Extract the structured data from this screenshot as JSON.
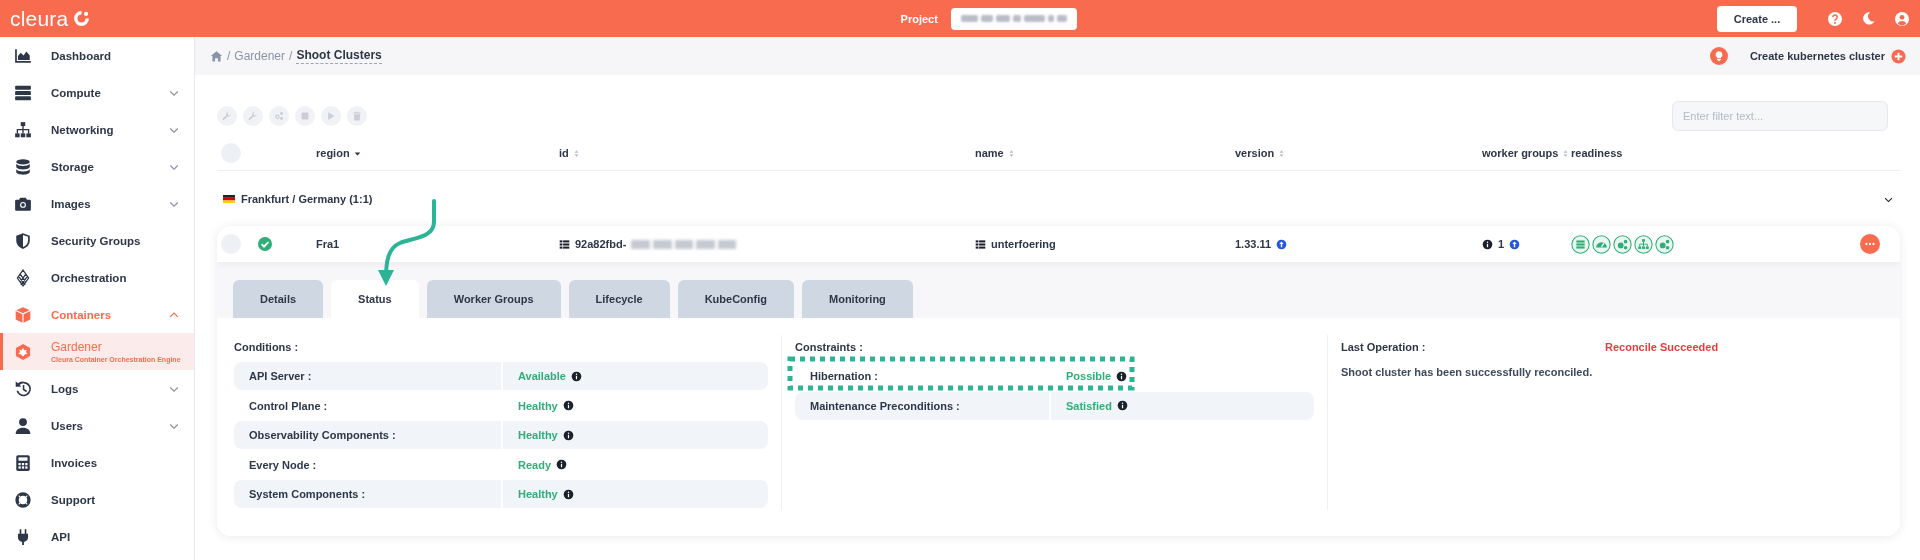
{
  "topbar": {
    "logo": "cleura",
    "project_label": "Project",
    "create_button": "Create ..."
  },
  "sidebar": {
    "items": [
      {
        "label": "Dashboard",
        "expandable": false,
        "expanded": false,
        "active": false,
        "selected": false
      },
      {
        "label": "Compute",
        "expandable": true,
        "expanded": false,
        "active": false,
        "selected": false
      },
      {
        "label": "Networking",
        "expandable": true,
        "expanded": false,
        "active": false,
        "selected": false
      },
      {
        "label": "Storage",
        "expandable": true,
        "expanded": false,
        "active": false,
        "selected": false
      },
      {
        "label": "Images",
        "expandable": true,
        "expanded": false,
        "active": false,
        "selected": false
      },
      {
        "label": "Security Groups",
        "expandable": false,
        "expanded": false,
        "active": false,
        "selected": false
      },
      {
        "label": "Orchestration",
        "expandable": false,
        "expanded": false,
        "active": false,
        "selected": false
      },
      {
        "label": "Containers",
        "expandable": true,
        "expanded": true,
        "active": true,
        "selected": false
      },
      {
        "label": "Gardener",
        "subtitle": "Cleura Container Orchestration Engine",
        "expandable": false,
        "expanded": false,
        "active": false,
        "selected": true
      },
      {
        "label": "Logs",
        "expandable": true,
        "expanded": false,
        "active": false,
        "selected": false
      },
      {
        "label": "Users",
        "expandable": true,
        "expanded": false,
        "active": false,
        "selected": false
      },
      {
        "label": "Invoices",
        "expandable": false,
        "expanded": false,
        "active": false,
        "selected": false
      },
      {
        "label": "Support",
        "expandable": false,
        "expanded": false,
        "active": false,
        "selected": false
      },
      {
        "label": "API",
        "expandable": false,
        "expanded": false,
        "active": false,
        "selected": false
      }
    ]
  },
  "breadcrumb": [
    {
      "kind": "home"
    },
    {
      "kind": "separator",
      "text": "/"
    },
    {
      "kind": "link",
      "text": "Gardener"
    },
    {
      "kind": "separator",
      "text": "/"
    },
    {
      "kind": "current",
      "text": "Shoot Clusters"
    }
  ],
  "create_cluster": "Create kubernetes cluster",
  "toolbar": [
    {
      "disabled": true
    },
    {
      "disabled": true
    },
    {
      "disabled": true
    },
    {
      "disabled": true
    },
    {
      "disabled": true
    },
    {
      "disabled": true
    }
  ],
  "filter": {
    "placeholder": "Enter filter text..."
  },
  "table": {
    "select_all": {
      "checked": false
    },
    "columns": [
      {
        "label": "region",
        "sortable": true,
        "sorted": true
      },
      {
        "label": "id",
        "sortable": true,
        "sorted": false
      },
      {
        "label": "name",
        "sortable": true,
        "sorted": false
      },
      {
        "label": "version",
        "sortable": true,
        "sorted": false
      },
      {
        "label": "worker groups",
        "sortable": true,
        "sorted": false
      },
      {
        "label": "readiness",
        "sortable": false,
        "sorted": false
      }
    ],
    "group": {
      "label": "Frankfurt / Germany (1:1)",
      "expanded": true
    },
    "row": {
      "checked": false,
      "healthy": true,
      "region": "Fra1",
      "id": "92a82fbd-",
      "name": "unterfoering",
      "version": "1.33.11",
      "version_upgradable": true,
      "worker_groups": "1",
      "workers_upgradable": true,
      "readiness": [
        {
          "ready": true
        },
        {
          "ready": true
        },
        {
          "ready": true
        },
        {
          "ready": true
        },
        {
          "ready": true
        }
      ]
    }
  },
  "tabs": [
    {
      "label": "Details",
      "selected": false
    },
    {
      "label": "Status",
      "selected": true
    },
    {
      "label": "Worker Groups",
      "selected": false
    },
    {
      "label": "Lifecycle",
      "selected": false
    },
    {
      "label": "KubeConfig",
      "selected": false
    },
    {
      "label": "Monitoring",
      "selected": false
    }
  ],
  "conditions": {
    "title": "Conditions :",
    "rows": [
      {
        "label": "API Server :",
        "value": "Available",
        "kind": "success"
      },
      {
        "label": "Control Plane :",
        "value": "Healthy",
        "kind": "success"
      },
      {
        "label": "Observability Components :",
        "value": "Healthy",
        "kind": "success"
      },
      {
        "label": "Every Node :",
        "value": "Ready",
        "kind": "success"
      },
      {
        "label": "System Components :",
        "value": "Healthy",
        "kind": "success"
      }
    ]
  },
  "constraints": {
    "title": "Constraints :",
    "rows": [
      {
        "label": "Hibernation :",
        "value": "Possible",
        "kind": "success"
      },
      {
        "label": "Maintenance Preconditions :",
        "value": "Satisfied",
        "kind": "success"
      }
    ]
  },
  "last_operation": {
    "label": "Last Operation :",
    "value": "Reconcile Succeeded",
    "kind": "error",
    "message": "Shoot cluster has been successfully reconciled."
  }
}
